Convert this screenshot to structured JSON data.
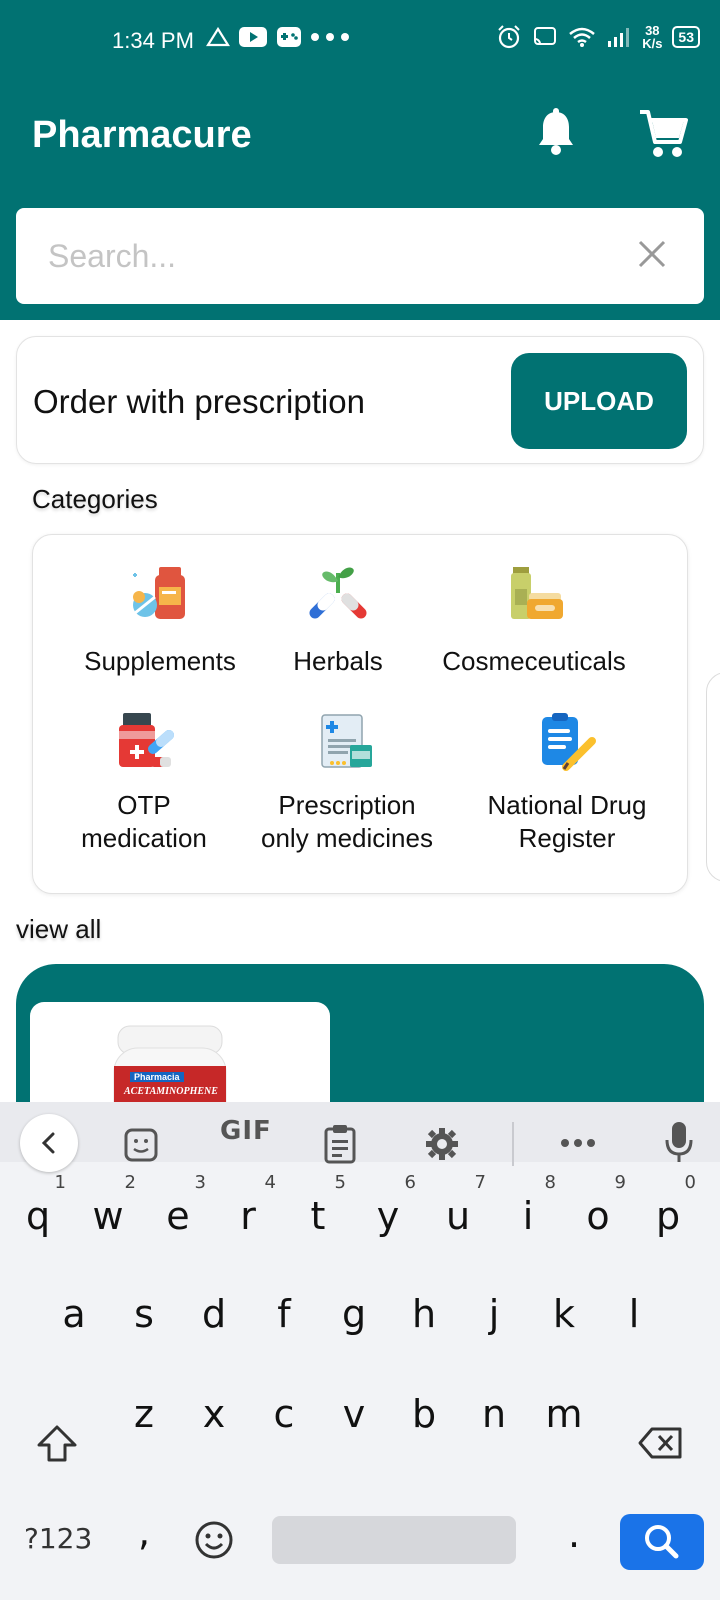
{
  "status_bar": {
    "time": "1:34 PM",
    "network_speed_value": "38",
    "network_speed_unit": "K/s",
    "battery": "53"
  },
  "app": {
    "title": "Pharmacure"
  },
  "search": {
    "placeholder": "Search..."
  },
  "prescription": {
    "label": "Order with prescription",
    "upload_label": "UPLOAD"
  },
  "categories": {
    "title": "Categories",
    "items": [
      {
        "line1": "Supplements",
        "line2": "",
        "icon": "supplements-icon"
      },
      {
        "line1": "Herbals",
        "line2": "",
        "icon": "herbals-icon"
      },
      {
        "line1": "Cosmeceuticals",
        "line2": "",
        "icon": "cosmeceuticals-icon"
      },
      {
        "line1": "OTP",
        "line2": "medication",
        "icon": "otp-medication-icon"
      },
      {
        "line1": "Prescription",
        "line2": "only medicines",
        "icon": "prescription-icon"
      },
      {
        "line1": "National Drug",
        "line2": "Register",
        "icon": "drug-register-icon"
      }
    ],
    "view_all": "view all"
  },
  "banner": {
    "product_label_brand": "Pharmacia",
    "product_label_name": "ACETAMINOPHENE"
  },
  "keyboard": {
    "toolbar_gif": "GIF",
    "row1": [
      "q",
      "w",
      "e",
      "r",
      "t",
      "y",
      "u",
      "i",
      "o",
      "p"
    ],
    "row1_hints": [
      "1",
      "2",
      "3",
      "4",
      "5",
      "6",
      "7",
      "8",
      "9",
      "0"
    ],
    "row2": [
      "a",
      "s",
      "d",
      "f",
      "g",
      "h",
      "j",
      "k",
      "l"
    ],
    "row3": [
      "z",
      "x",
      "c",
      "v",
      "b",
      "n",
      "m"
    ],
    "symbols_key": "?123",
    "comma": ",",
    "period": "."
  },
  "colors": {
    "brand": "#017272",
    "accent_key": "#1a73e8"
  }
}
